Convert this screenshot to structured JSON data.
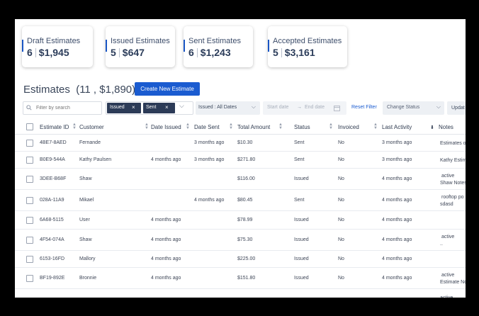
{
  "summary_cards": [
    {
      "title": "Draft Estimates",
      "count": "6",
      "amount": "$1,945"
    },
    {
      "title": "Issued Estimates",
      "count": "5",
      "amount": "$647"
    },
    {
      "title": "Sent Estimates",
      "count": "6",
      "amount": "$1,243"
    },
    {
      "title": "Accepted Estimates",
      "count": "5",
      "amount": "$3,161"
    }
  ],
  "heading": {
    "title": "Estimates",
    "summary": "(11 , $1,890)",
    "create_label": "Create New Estimate"
  },
  "filters": {
    "search_placeholder": "Filter by search",
    "chips": [
      "Issued",
      "Sent"
    ],
    "chip_remove": "×",
    "date_filter": "Issued : All Dates",
    "start_date": "Start date",
    "arrow": "→",
    "end_date": "End date",
    "reset_label": "Reset Filter",
    "change_status": "Change Status",
    "update_label": "Updat"
  },
  "table": {
    "columns": [
      "Estimate ID",
      "Customer",
      "Date Issued",
      "Date Sent",
      "Total Amount",
      "Status",
      "Invoiced",
      "Last Activity",
      "Notes"
    ],
    "rows": [
      {
        "id": "4BE7-8AED",
        "customer": "Fernande",
        "date_issued": "",
        "date_sent": "3 months ago",
        "total": "$10.30",
        "status": "Sent",
        "invoiced": "No",
        "last_activity": "3 months ago",
        "notes": [
          "Estimates o"
        ]
      },
      {
        "id": "B0E9-544A",
        "customer": "Kathy Paulsen",
        "date_issued": "4 months ago",
        "date_sent": "3 months ago",
        "total": "$271.80",
        "status": "Sent",
        "invoiced": "No",
        "last_activity": "3 months ago",
        "notes": [
          "Kathy Estim"
        ]
      },
      {
        "id": "3DEE-B68F",
        "customer": "Shaw",
        "date_issued": "",
        "date_sent": "",
        "total": "$116.00",
        "status": "Issued",
        "invoiced": "No",
        "last_activity": "4 months ago",
        "notes": [
          "active",
          "Shaw Notes"
        ]
      },
      {
        "id": "028A-11A9",
        "customer": "Mikael",
        "date_issued": "",
        "date_sent": "4 months ago",
        "total": "$80.45",
        "status": "Sent",
        "invoiced": "No",
        "last_activity": "4 months ago",
        "notes": [
          "rooftop po",
          "sdasd"
        ]
      },
      {
        "id": "6A68-5115",
        "customer": "User",
        "date_issued": "4 months ago",
        "date_sent": "",
        "total": "$78.99",
        "status": "Issued",
        "invoiced": "No",
        "last_activity": "4 months ago",
        "notes": []
      },
      {
        "id": "4F54-074A",
        "customer": "Shaw",
        "date_issued": "4 months ago",
        "date_sent": "",
        "total": "$75.30",
        "status": "Issued",
        "invoiced": "No",
        "last_activity": "4 months ago",
        "notes": [
          "active",
          ".."
        ]
      },
      {
        "id": "6153-16FD",
        "customer": "Mallory",
        "date_issued": "4 months ago",
        "date_sent": "",
        "total": "$225.00",
        "status": "Issued",
        "invoiced": "No",
        "last_activity": "4 months ago",
        "notes": []
      },
      {
        "id": "BF19-892E",
        "customer": "Bronnie",
        "date_issued": "4 months ago",
        "date_sent": "",
        "total": "$151.80",
        "status": "Issued",
        "invoiced": "No",
        "last_activity": "4 months ago",
        "notes": [
          "active",
          "Estimate No"
        ]
      },
      {
        "id": "",
        "customer": "",
        "date_issued": "",
        "date_sent": "",
        "total": "",
        "status": "",
        "invoiced": "",
        "last_activity": "",
        "notes": [
          "active"
        ]
      }
    ]
  },
  "colors": {
    "accent": "#1a5bd0",
    "chip": "#2c3b57"
  }
}
